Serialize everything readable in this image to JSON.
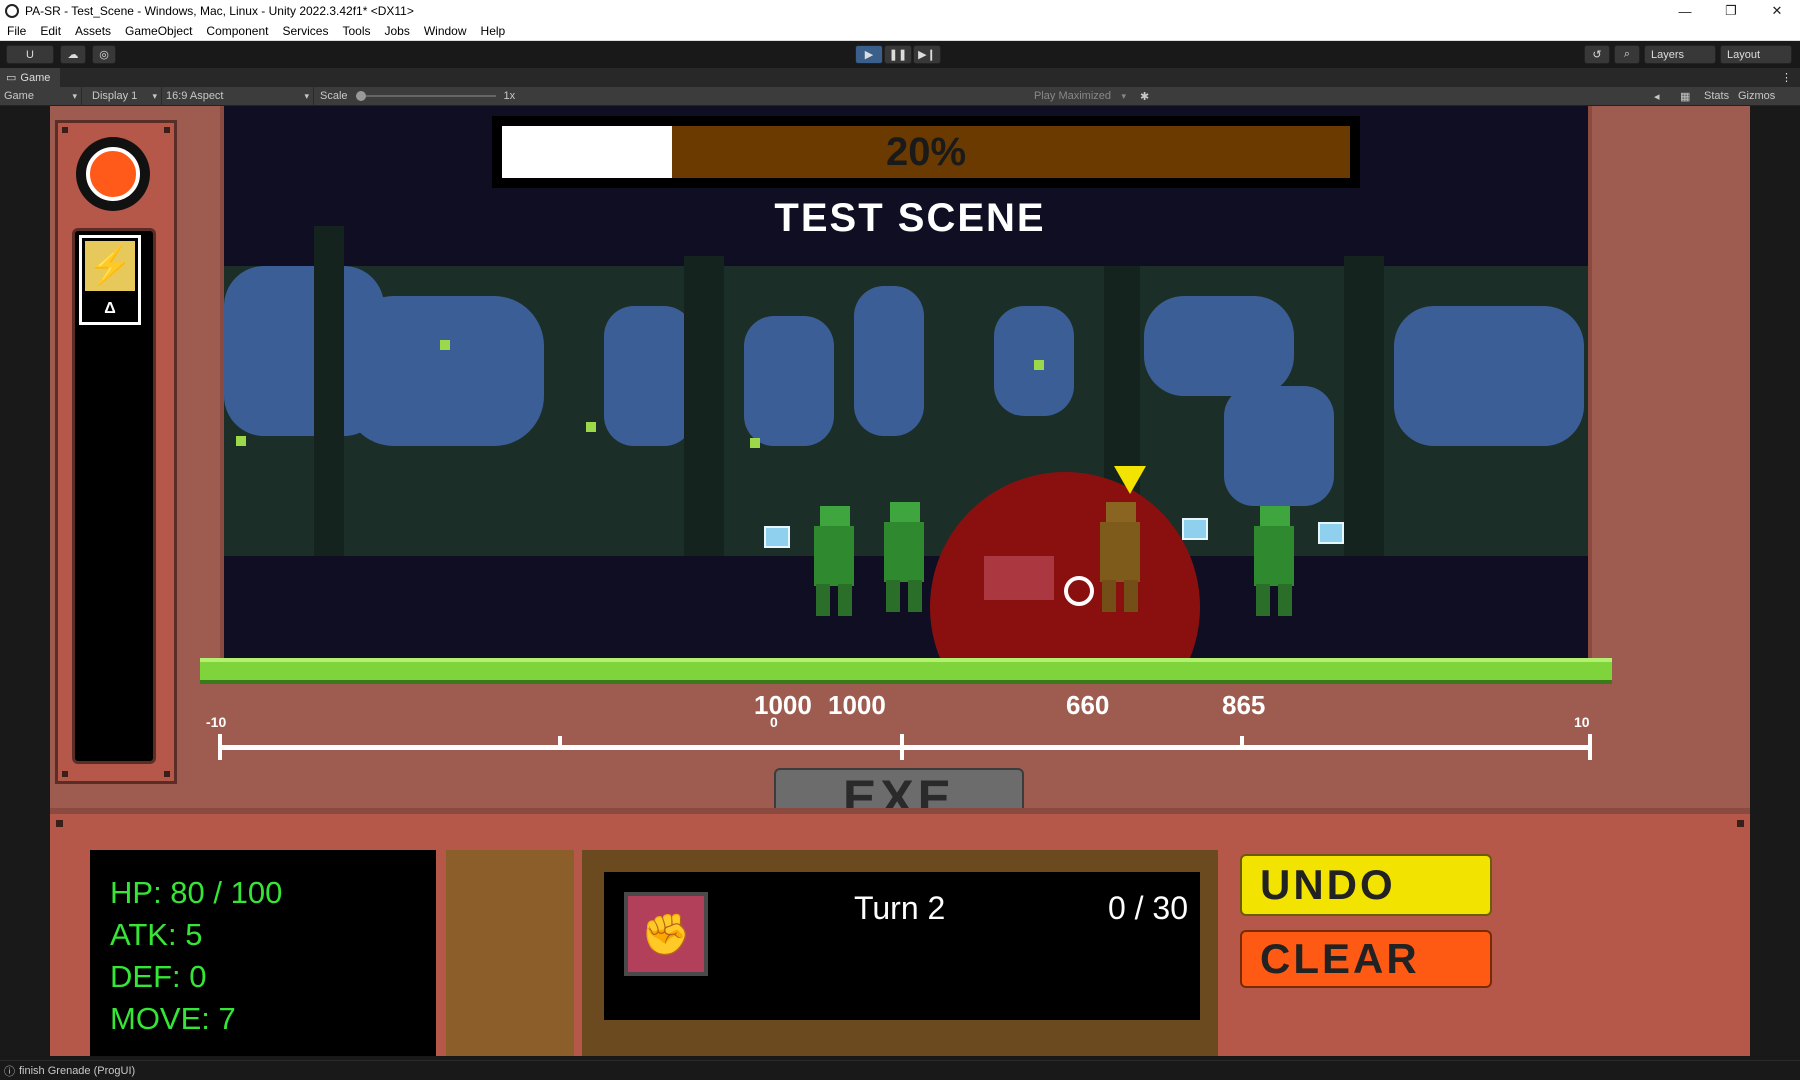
{
  "window": {
    "title": "PA-SR - Test_Scene - Windows, Mac, Linux - Unity 2022.3.42f1* <DX11>",
    "minimize": "—",
    "maximize": "❐",
    "close": "✕"
  },
  "menu": [
    "File",
    "Edit",
    "Assets",
    "GameObject",
    "Component",
    "Services",
    "Tools",
    "Jobs",
    "Window",
    "Help"
  ],
  "toolbar": {
    "account": "U",
    "play": "▶",
    "pause": "❚❚",
    "step": "▶❙",
    "layers": "Layers",
    "layout": "Layout"
  },
  "game_tab": {
    "label": "Game"
  },
  "game_bar": {
    "mode": "Game",
    "display": "Display 1",
    "aspect": "16:9 Aspect",
    "scale_label": "Scale",
    "scale_value": "1x",
    "play_maximized": "Play Maximized",
    "stats": "Stats",
    "gizmos": "Gizmos"
  },
  "hud": {
    "progress_label": "20%",
    "progress_fraction": 0.2,
    "scene_title": "TEST SCENE",
    "energy_delta": "Δ",
    "energy_bolt": "⚡"
  },
  "units": {
    "hp_labels": [
      "1000",
      "1000",
      "660",
      "865"
    ]
  },
  "axis": {
    "min_label": "-10",
    "mid_label": "0",
    "max_label": "10"
  },
  "exe_button": "EXE",
  "stats": {
    "hp": "HP: 80 / 100",
    "atk": "ATK: 5",
    "def": "DEF: 0",
    "move": "MOVE: 7"
  },
  "card_panel": {
    "turn": "Turn 2",
    "count": "0 / 30",
    "card_icon": "✊"
  },
  "undo_button": "UNDO",
  "clear_button": "CLEAR",
  "status_bar": {
    "message": "finish Grenade (ProgUI)"
  }
}
